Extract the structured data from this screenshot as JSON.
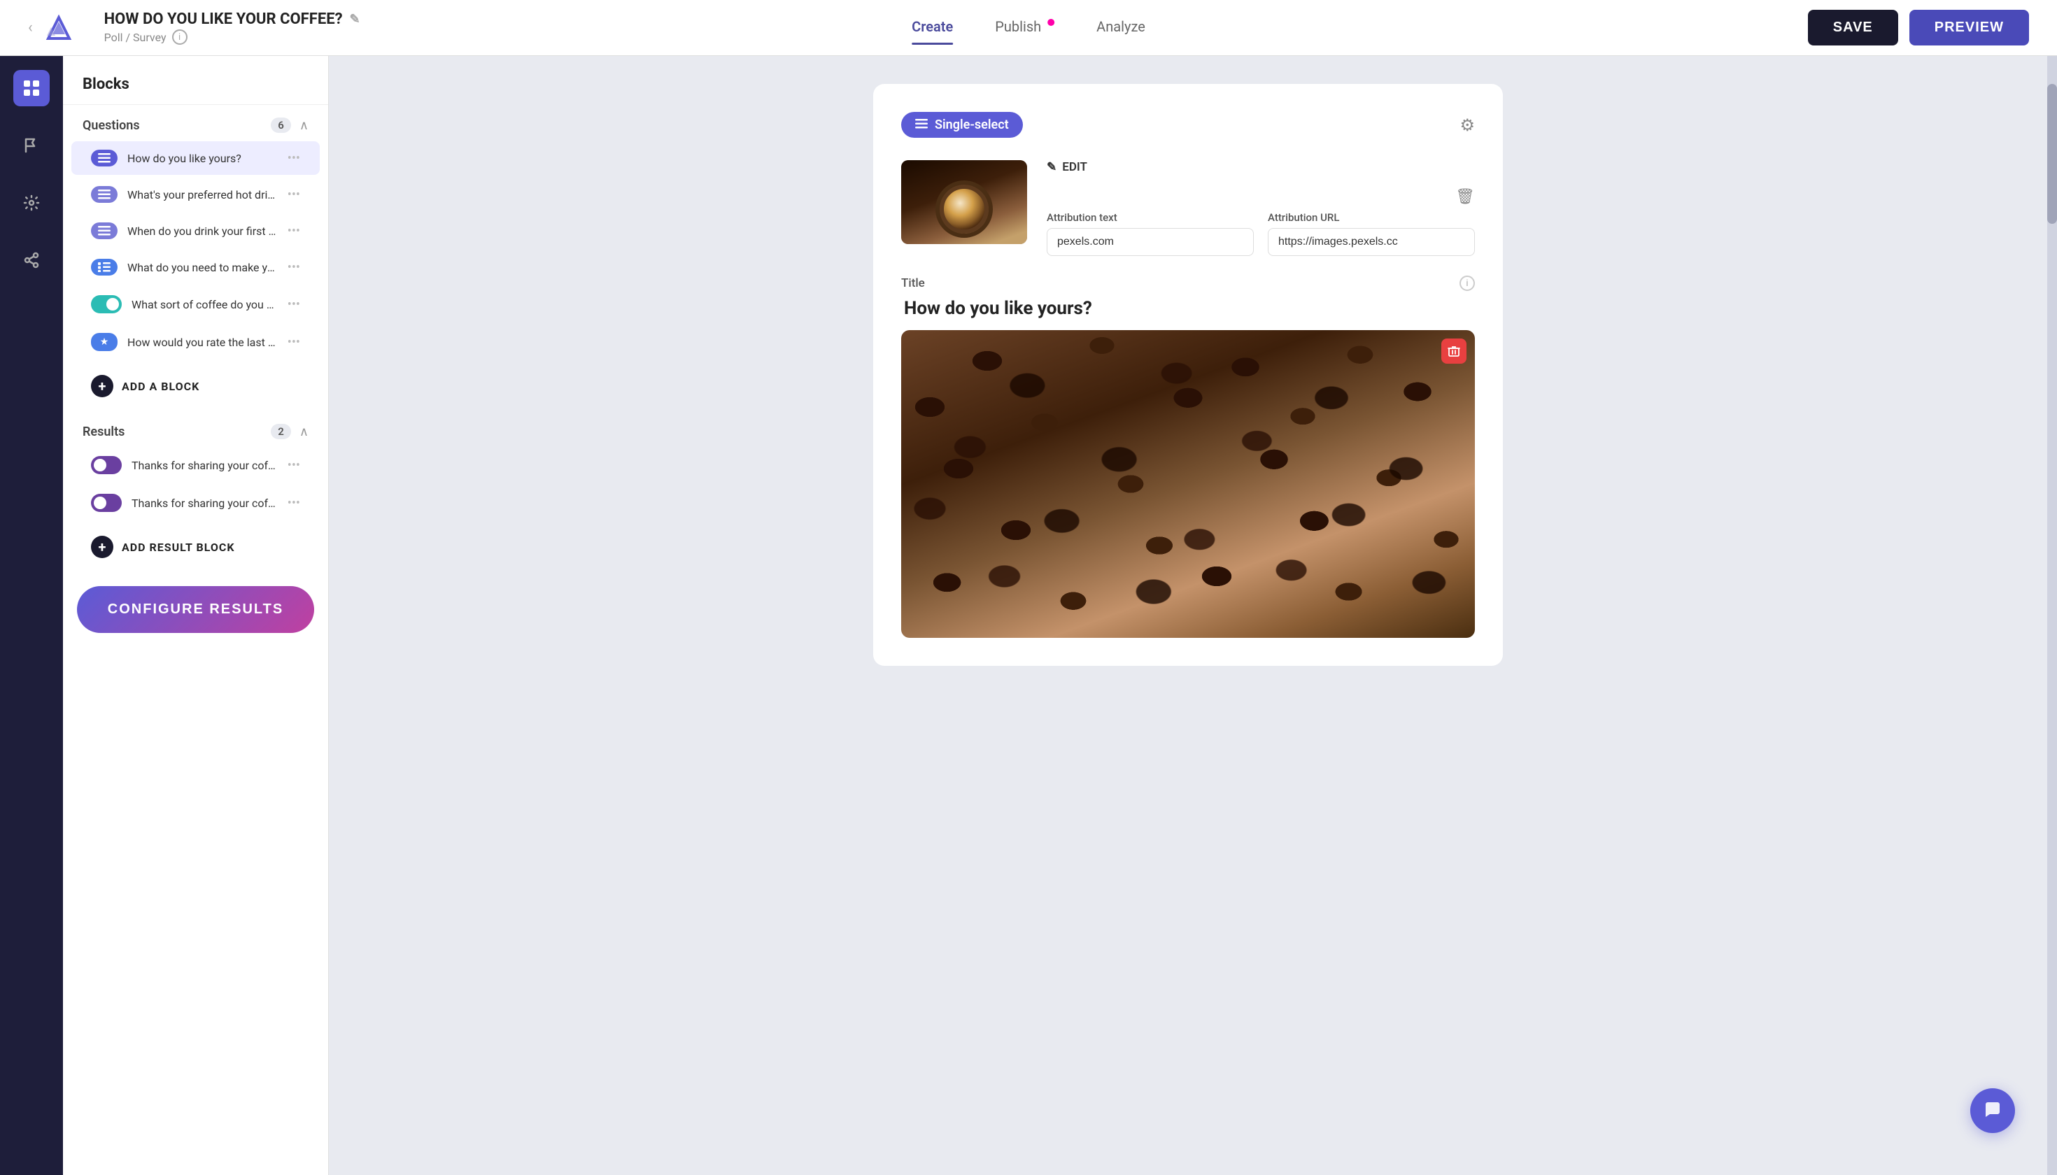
{
  "navbar": {
    "title": "HOW DO YOU LIKE YOUR COFFEE?",
    "subtitle": "Poll / Survey",
    "edit_icon": "✎",
    "nav_items": [
      {
        "label": "Create",
        "active": true,
        "badge": false
      },
      {
        "label": "Publish",
        "active": false,
        "badge": true
      },
      {
        "label": "Analyze",
        "active": false,
        "badge": false
      }
    ],
    "save_label": "SAVE",
    "preview_label": "PREVIEW"
  },
  "sidebar": {
    "blocks_label": "Blocks",
    "questions_label": "Questions",
    "questions_count": "6",
    "questions": [
      {
        "label": "How do you like yours?",
        "selected": true,
        "icon_type": "list-purple"
      },
      {
        "label": "What's your preferred hot drin...",
        "selected": false,
        "icon_type": "list-purple-light"
      },
      {
        "label": "When do you drink your first c...",
        "selected": false,
        "icon_type": "list-purple-light"
      },
      {
        "label": "What do you need to make yo...",
        "selected": false,
        "icon_type": "list-blue"
      },
      {
        "label": "What sort of coffee do you or...",
        "selected": false,
        "icon_type": "toggle-teal"
      },
      {
        "label": "How would you rate the last c...",
        "selected": false,
        "icon_type": "star-blue"
      }
    ],
    "add_block_label": "ADD A BLOCK",
    "results_label": "Results",
    "results_count": "2",
    "results": [
      {
        "label": "Thanks for sharing your coffe...",
        "icon_type": "toggle-off"
      },
      {
        "label": "Thanks for sharing your coffe...",
        "icon_type": "toggle-off"
      }
    ],
    "add_result_label": "ADD RESULT BLOCK",
    "configure_label": "CONFIGURE RESULTS"
  },
  "card": {
    "type_label": "Single-select",
    "attribution_text_label": "Attribution text",
    "attribution_text_value": "pexels.com",
    "attribution_url_label": "Attribution URL",
    "attribution_url_value": "https://images.pexels.cc",
    "title_label": "Title",
    "title_value": "How do you like yours?",
    "edit_label": "EDIT"
  },
  "icons": {
    "list_icon": "≡",
    "gear_icon": "⚙",
    "trash_icon": "🗑",
    "edit_pencil": "✎",
    "plus_icon": "+",
    "dots_icon": "•••",
    "chevron_up": "∧",
    "info_icon": "i",
    "chat_icon": "💬",
    "grid_icon": "⊞",
    "flag_icon": "⚑",
    "settings_icon": "⚙",
    "share_icon": "↗"
  }
}
